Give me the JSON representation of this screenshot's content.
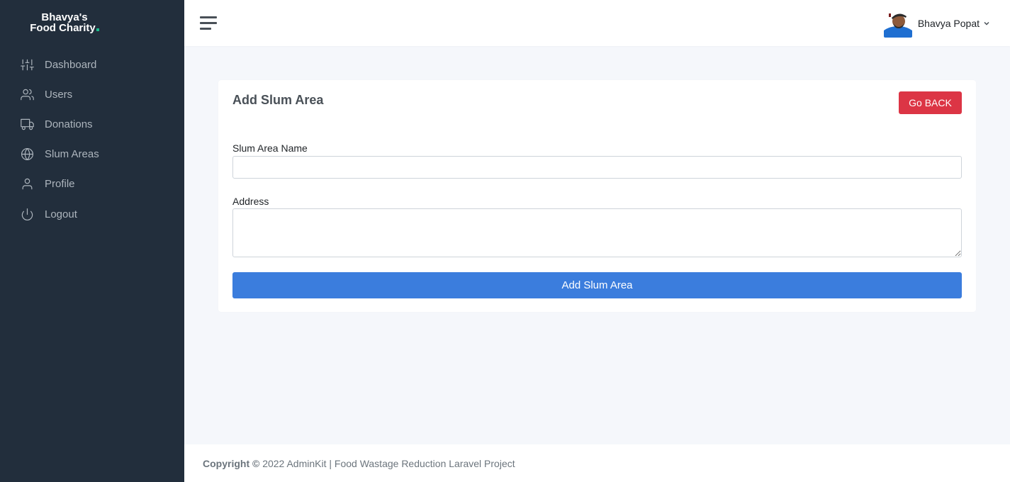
{
  "brand": {
    "line1": "Bhavya's",
    "line2": "Food Charity",
    "accent_color": "#1cbb8c"
  },
  "sidebar": {
    "items": [
      {
        "label": "Dashboard",
        "icon": "sliders-icon"
      },
      {
        "label": "Users",
        "icon": "users-icon"
      },
      {
        "label": "Donations",
        "icon": "truck-icon"
      },
      {
        "label": "Slum Areas",
        "icon": "globe-icon"
      },
      {
        "label": "Profile",
        "icon": "user-icon"
      },
      {
        "label": "Logout",
        "icon": "power-icon"
      }
    ]
  },
  "topbar": {
    "user_name": "Bhavya Popat"
  },
  "form": {
    "title": "Add Slum Area",
    "back_label": "Go BACK",
    "name_label": "Slum Area Name",
    "name_value": "",
    "address_label": "Address",
    "address_value": "",
    "submit_label": "Add Slum Area"
  },
  "footer": {
    "copyright_bold": "Copyright ©",
    "text": " 2022 AdminKit | Food Wastage Reduction Laravel Project"
  },
  "colors": {
    "sidebar_bg": "#222e3c",
    "primary": "#3b7ddd",
    "danger": "#dc3545"
  }
}
